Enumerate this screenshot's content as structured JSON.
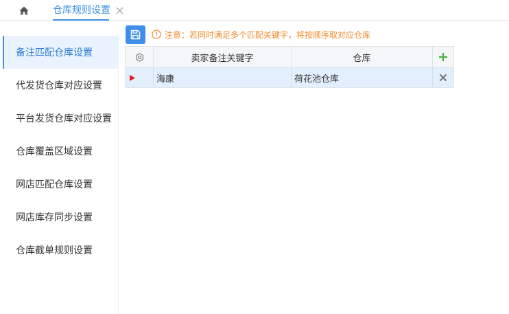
{
  "tabbar": {
    "home_icon": "home-icon",
    "active_tab": {
      "label": "仓库规则设置",
      "close_icon": "close-icon"
    }
  },
  "sidebar": {
    "items": [
      {
        "label": "备注匹配仓库设置",
        "active": true
      },
      {
        "label": "代发货仓库对应设置",
        "active": false
      },
      {
        "label": "平台发货仓库对应设置",
        "active": false
      },
      {
        "label": "仓库覆盖区域设置",
        "active": false
      },
      {
        "label": "网店匹配仓库设置",
        "active": false
      },
      {
        "label": "网店库存同步设置",
        "active": false
      },
      {
        "label": "仓库截单规则设置",
        "active": false
      }
    ]
  },
  "toolbar": {
    "save_icon": "save-icon",
    "notice_icon": "info-circle-icon",
    "notice": "注意：若同时满足多个匹配关键字，将按顺序取对应仓库"
  },
  "grid": {
    "columns": [
      "卖家备注关键字",
      "仓库"
    ],
    "rows": [
      {
        "keyword": "海康",
        "warehouse": "荷花池仓库"
      }
    ]
  },
  "colors": {
    "accent": "#3d8fe0",
    "notice": "#f08b2c",
    "add": "#4caf3a",
    "row_marker": "#e02020",
    "selected_row": "#e4effd"
  }
}
